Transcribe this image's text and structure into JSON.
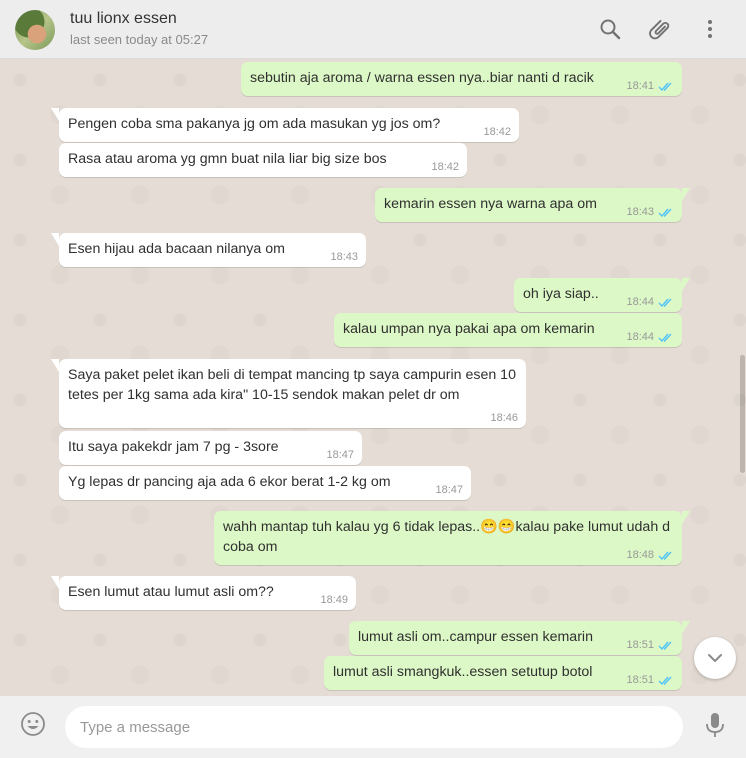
{
  "header": {
    "contact_name": "tuu lionx essen",
    "last_seen": "last seen today at 05:27",
    "icons": [
      "search-icon",
      "attach-icon",
      "menu-icon"
    ]
  },
  "messages": [
    {
      "dir": "out",
      "text": "sebutin aja aroma / warna essen nya..biar nanti d racik",
      "time": "18:41",
      "ticks": true
    },
    {
      "dir": "in",
      "text": "Pengen coba sma pakanya jg om ada masukan yg jos om?",
      "time": "18:42"
    },
    {
      "dir": "in",
      "text": "Rasa atau aroma yg gmn buat nila liar big size bos",
      "time": "18:42"
    },
    {
      "dir": "out",
      "text": "kemarin essen nya warna apa om",
      "time": "18:43",
      "ticks": true
    },
    {
      "dir": "in",
      "text": "Esen hijau ada bacaan nilanya om",
      "time": "18:43"
    },
    {
      "dir": "out",
      "text": "oh iya siap..",
      "time": "18:44",
      "ticks": true
    },
    {
      "dir": "out",
      "text": "kalau umpan nya pakai apa om kemarin",
      "time": "18:44",
      "ticks": true
    },
    {
      "dir": "in",
      "text": "Saya paket pelet ikan beli di tempat mancing tp saya campurin esen 10 tetes per 1kg sama ada kira\" 10-15 sendok makan pelet dr om",
      "time": "18:46"
    },
    {
      "dir": "in",
      "text": "Itu saya pakekdr jam 7 pg - 3sore",
      "time": "18:47"
    },
    {
      "dir": "in",
      "text": "Yg lepas dr pancing aja ada 6 ekor berat 1-2 kg om",
      "time": "18:47"
    },
    {
      "dir": "out",
      "text": "wahh mantap tuh kalau yg 6 tidak lepas..😁😁kalau pake lumut udah d coba om",
      "time": "18:48",
      "ticks": true
    },
    {
      "dir": "in",
      "text": "Esen lumut atau lumut asli om??",
      "time": "18:49"
    },
    {
      "dir": "out",
      "text": "lumut asli om..campur essen kemarin",
      "time": "18:51",
      "ticks": true
    },
    {
      "dir": "out",
      "text": "lumut asli smangkuk..essen setutup botol",
      "time": "18:51",
      "ticks": true
    }
  ],
  "composer": {
    "placeholder": "Type a message"
  },
  "colors": {
    "outgoing_bubble": "#dcf8c6",
    "incoming_bubble": "#ffffff",
    "read_ticks": "#4fc3f7",
    "chat_background": "#e5ddd5"
  }
}
